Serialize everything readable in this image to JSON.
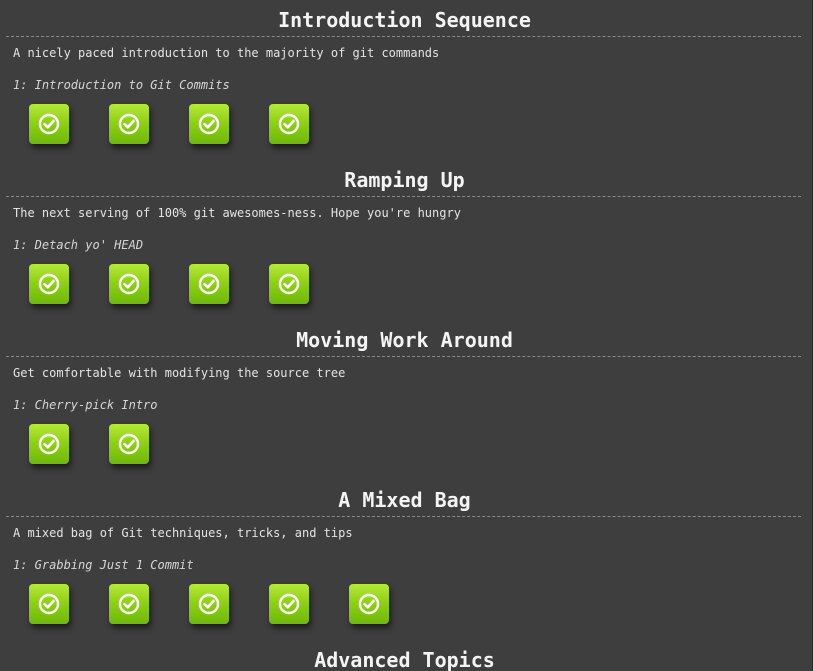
{
  "sequences": [
    {
      "title": "Introduction Sequence",
      "about": "A nicely paced introduction to the majority of git commands",
      "selected_level": "1: Introduction to Git Commits",
      "level_count": 4
    },
    {
      "title": "Ramping Up",
      "about": "The next serving of 100% git awesomes-ness. Hope you're hungry",
      "selected_level": "1: Detach yo' HEAD",
      "level_count": 4
    },
    {
      "title": "Moving Work Around",
      "about": "Get comfortable with modifying the source tree",
      "selected_level": "1: Cherry-pick Intro",
      "level_count": 2
    },
    {
      "title": "A Mixed Bag",
      "about": "A mixed bag of Git techniques, tricks, and tips",
      "selected_level": "1: Grabbing Just 1 Commit",
      "level_count": 5
    },
    {
      "title": "Advanced Topics"
    }
  ],
  "level_status_icon": "checkmark-circle-icon",
  "colors": {
    "background": "#3e3e3e",
    "level_complete": "#8fd214"
  }
}
